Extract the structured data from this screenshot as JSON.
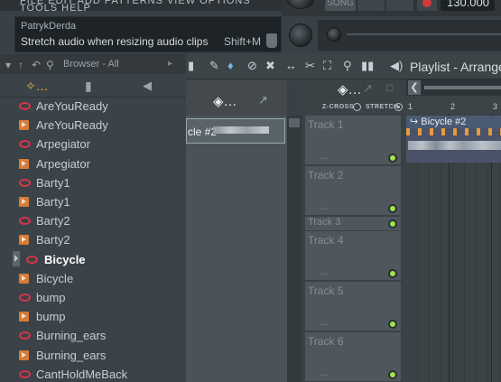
{
  "menu": {
    "items": [
      "FILE",
      "EDIT",
      "ADD",
      "PATTERNS",
      "VIEW",
      "OPTIONS",
      "TOOLS",
      "HELP"
    ],
    "text": "FILE EDIT ADD PATTERNS VIEW OPTIONS TOOLS HELP"
  },
  "transport": {
    "song_label": "SONG",
    "tempo": "130.000"
  },
  "hint": {
    "user": "PatrykDerda",
    "text": "Stretch audio when resizing audio clips",
    "shortcut": "Shift+M"
  },
  "browser": {
    "title": "Browser - All",
    "selected_index": 8,
    "items": [
      {
        "label": "AreYouReady",
        "type": "audio-clip"
      },
      {
        "label": "AreYouReady",
        "type": "pattern"
      },
      {
        "label": "Arpegiator",
        "type": "audio-clip"
      },
      {
        "label": "Arpegiator",
        "type": "pattern"
      },
      {
        "label": "Barty1",
        "type": "audio-clip"
      },
      {
        "label": "Barty1",
        "type": "pattern"
      },
      {
        "label": "Barty2",
        "type": "audio-clip"
      },
      {
        "label": "Barty2",
        "type": "pattern"
      },
      {
        "label": "Bicycle",
        "type": "audio-clip"
      },
      {
        "label": "Bicycle",
        "type": "pattern"
      },
      {
        "label": "bump",
        "type": "audio-clip"
      },
      {
        "label": "bump",
        "type": "pattern"
      },
      {
        "label": "Burning_ears",
        "type": "audio-clip"
      },
      {
        "label": "Burning_ears",
        "type": "pattern"
      },
      {
        "label": "CantHoldMeBack",
        "type": "audio-clip"
      }
    ]
  },
  "playlist": {
    "title": "Playlist - Arrange",
    "picker_clip_label": "cle #2",
    "zcross_label": "Z-CROSS",
    "stretch_label": "STRETCH",
    "ruler": [
      "1",
      "2",
      "3"
    ],
    "clip_label": "Bicycle #2",
    "tracks": [
      {
        "name": "Track 1",
        "dots": "..."
      },
      {
        "name": "Track 2",
        "dots": "..."
      },
      {
        "name": "Track 3",
        "dots": ""
      },
      {
        "name": "Track 4",
        "dots": "..."
      },
      {
        "name": "Track 5",
        "dots": "..."
      },
      {
        "name": "Track 6",
        "dots": "..."
      }
    ]
  },
  "colors": {
    "accent_orange": "#e8b153",
    "track_led": "#9ee54c",
    "clip_icon": "#d8344a",
    "pattern_icon": "#d67b39"
  }
}
